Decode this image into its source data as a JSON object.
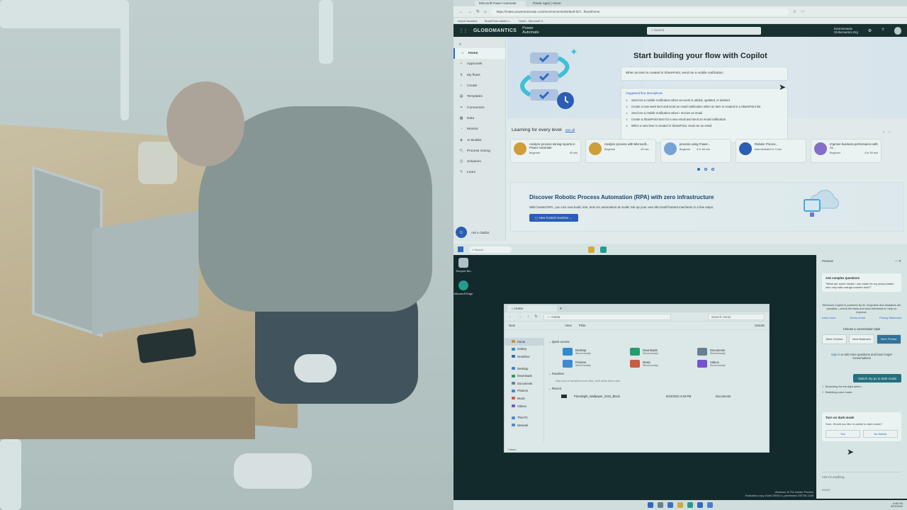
{
  "browser": {
    "tabs": [
      "Microsoft Power Automate",
      "Power Apps | Home"
    ],
    "url": "https://make.powerautomate.com/environments/Default-fa7/...flows/home",
    "favorites": [
      "Import favorites",
      "SharePoint admin c...",
      "Home - Microsoft 3..."
    ]
  },
  "header": {
    "logo": "GLOBOMANTICS",
    "product": "Power Automate",
    "search_placeholder": "Search",
    "env_label": "Environments",
    "env_value": "Globomantics.Org"
  },
  "sidebar": {
    "items": [
      {
        "label": "Home",
        "icon": "home-icon"
      },
      {
        "label": "Approvals",
        "icon": "approvals-icon"
      },
      {
        "label": "My flows",
        "icon": "flows-icon"
      },
      {
        "label": "Create",
        "icon": "plus-icon"
      },
      {
        "label": "Templates",
        "icon": "templates-icon"
      },
      {
        "label": "Connectors",
        "icon": "connectors-icon"
      },
      {
        "label": "Data",
        "icon": "data-icon"
      },
      {
        "label": "Monitor",
        "icon": "monitor-icon"
      },
      {
        "label": "AI Builder",
        "icon": "ai-icon"
      },
      {
        "label": "Process mining",
        "icon": "mining-icon"
      },
      {
        "label": "Solutions",
        "icon": "solutions-icon"
      },
      {
        "label": "Learn",
        "icon": "learn-icon"
      }
    ],
    "chatbot": "Ask a chatbot"
  },
  "hero": {
    "title": "Start building your flow with Copilot",
    "prompt": "When an item is created in SharePoint, send me a mobile notification",
    "suggest_header": "Suggested flow descriptions",
    "suggestions": [
      "Send me a mobile notification when an event is added, updated, or deleted",
      "Create a new work item and send an email notification when an item is created in a SharePoint list",
      "Send me a mobile notification when I receive an email",
      "Create a SharePoint item for a new email and send an email notification",
      "When a new item is created in SharePoint, send me an email"
    ]
  },
  "learning": {
    "title": "Learning for every level",
    "see_all": "See all",
    "cards": [
      {
        "title": "Analyze process mining reports in Power Automate",
        "level": "Beginner",
        "time": "40 min"
      },
      {
        "title": "Analyze process with Microsoft...",
        "level": "Beginner",
        "time": "43 min"
      },
      {
        "title": "process using Power...",
        "level": "Beginner",
        "time": "4 hr 50 min"
      },
      {
        "title": "Robotic Proces...",
        "level": "Intermediate",
        "time": "2 hr 3 min"
      },
      {
        "title": "Improve business performance with AI...",
        "level": "Beginner",
        "time": "4 hr 50 min"
      }
    ]
  },
  "rpa": {
    "title": "Discover Robotic Process Automation (RPA) with zero infrastructure",
    "desc": "With hosted RPA, you can now build, test, and run automation at scale! Set up your own Microsoft-hosted machines in a few steps.",
    "button": "New hosted machine"
  },
  "taskbar_top": {
    "search": "Search"
  },
  "desktop": {
    "icons": [
      "Recycle Bin",
      "Microsoft Edge"
    ]
  },
  "explorer": {
    "tab": "Home",
    "path": "Home",
    "search_placeholder": "Search Home",
    "cmd": [
      "New",
      "View",
      "Filter",
      "Details"
    ],
    "nav": [
      {
        "label": "Home",
        "color": "#e08a2c"
      },
      {
        "label": "Gallery",
        "color": "#2b8ad6"
      },
      {
        "label": "OneDrive",
        "color": "#2b63c8"
      },
      {
        "label": "Desktop",
        "color": "#2b8ad6"
      },
      {
        "label": "Downloads",
        "color": "#1d9e6a"
      },
      {
        "label": "Documents",
        "color": "#6b7e8e"
      },
      {
        "label": "Pictures",
        "color": "#3a89d5"
      },
      {
        "label": "Music",
        "color": "#d5553a"
      },
      {
        "label": "Videos",
        "color": "#7a4ad5"
      },
      {
        "label": "This PC",
        "color": "#4a8ad5"
      },
      {
        "label": "Network",
        "color": "#4a8ad5"
      }
    ],
    "quick_access_title": "Quick access",
    "quick": [
      {
        "name": "Desktop",
        "sub": "Stored locally",
        "color": "#2b8ad6"
      },
      {
        "name": "Downloads",
        "sub": "Stored locally",
        "color": "#1d9e6a"
      },
      {
        "name": "Documents",
        "sub": "Stored locally",
        "color": "#6b7e8e"
      },
      {
        "name": "Pictures",
        "sub": "Stored locally",
        "color": "#3a89d5"
      },
      {
        "name": "Music",
        "sub": "Stored locally",
        "color": "#d5553a"
      },
      {
        "name": "Videos",
        "sub": "Stored locally",
        "color": "#7a4ad5"
      }
    ],
    "favorites_title": "Favorites",
    "favorites_empty": "After you've favorited some files, we'll show them here.",
    "recent_title": "Recent",
    "recent": {
      "name": "Pluralsight_Wallpaper_2022_Black",
      "date": "8/22/2023 4:48 PM",
      "loc": "Documents"
    },
    "status": "7 items"
  },
  "copilot": {
    "header": "Preview",
    "ask_title": "Ask complex questions",
    "ask_text": "\"What are some meals I can make for my picky toddler who only eats orange-colored food?\"",
    "powered": "Windows Copilot is powered by AI. Surprises and mistakes are possible—check the facts and send feedback to help us improve.",
    "links": [
      "Learn more",
      "Terms of use",
      "Privacy Statement"
    ],
    "style_title": "Choose a conversation style",
    "styles": [
      "More Creative",
      "More Balanced",
      "More Precise"
    ],
    "sign_in_link": "Sign in",
    "sign_in": "to ask more questions and have longer conversations",
    "action": "Switch my pc to dark mode",
    "checks": [
      "Searching for the right action",
      "Switching color mode"
    ],
    "card_title": "Turn on dark mode",
    "card_text": "Sure. Would you like to switch to dark mode?",
    "yes": "Yes",
    "no": "No thanks",
    "input_placeholder": "Ask me anything...",
    "counter": "0/4000"
  },
  "watermark": {
    "line1": "Windows 11 Pro Insider Preview",
    "line2": "Evaluation copy. Build 25916.rs_prerelease.230728-1428"
  },
  "clock": {
    "time": "5:48 PM",
    "date": "8/29/2023"
  }
}
